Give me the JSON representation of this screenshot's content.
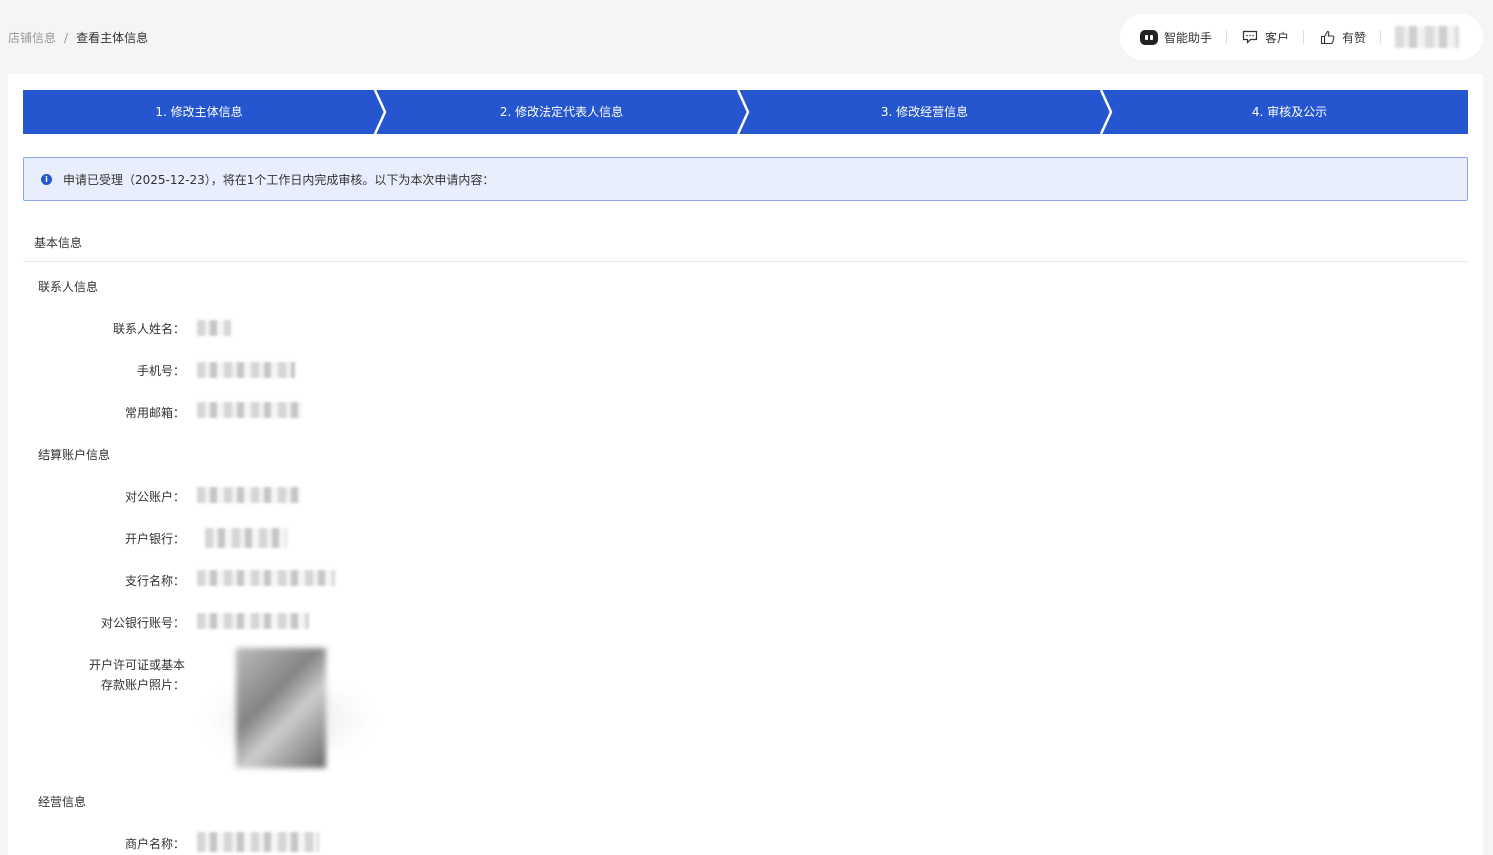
{
  "breadcrumb": {
    "parent": "店铺信息",
    "separator": "/",
    "current": "查看主体信息"
  },
  "toolbar": {
    "assistant_label": "智能助手",
    "assistant_icon": "robot-icon",
    "customer_label": "客户",
    "customer_icon": "chat-icon",
    "youzan_label": "有赞",
    "youzan_icon": "thumbs-up-icon"
  },
  "steps": [
    {
      "label": "1. 修改主体信息"
    },
    {
      "label": "2. 修改法定代表人信息"
    },
    {
      "label": "3. 修改经营信息"
    },
    {
      "label": "4. 审核及公示"
    }
  ],
  "colors": {
    "step_blue": "#2656cf",
    "notice_bg": "#e8eefc",
    "notice_border": "#8aa5ea"
  },
  "notice": {
    "icon": "info-icon",
    "text": "申请已受理（2025-12-23），将在1个工作日内完成审核。以下为本次申请内容："
  },
  "basic": {
    "title": "基本信息"
  },
  "contact": {
    "title": "联系人信息",
    "name_label": "联系人姓名：",
    "phone_label": "手机号：",
    "email_label": "常用邮箱："
  },
  "settlement": {
    "title": "结算账户信息",
    "account_label": "对公账户：",
    "bank_label": "开户银行：",
    "branch_label": "支行名称：",
    "account_no_label": "对公银行账号：",
    "photo_label_line1": "开户许可证或基本",
    "photo_label_line2": "存款账户照片："
  },
  "business": {
    "title": "经营信息",
    "merchant_name_label": "商户名称："
  }
}
